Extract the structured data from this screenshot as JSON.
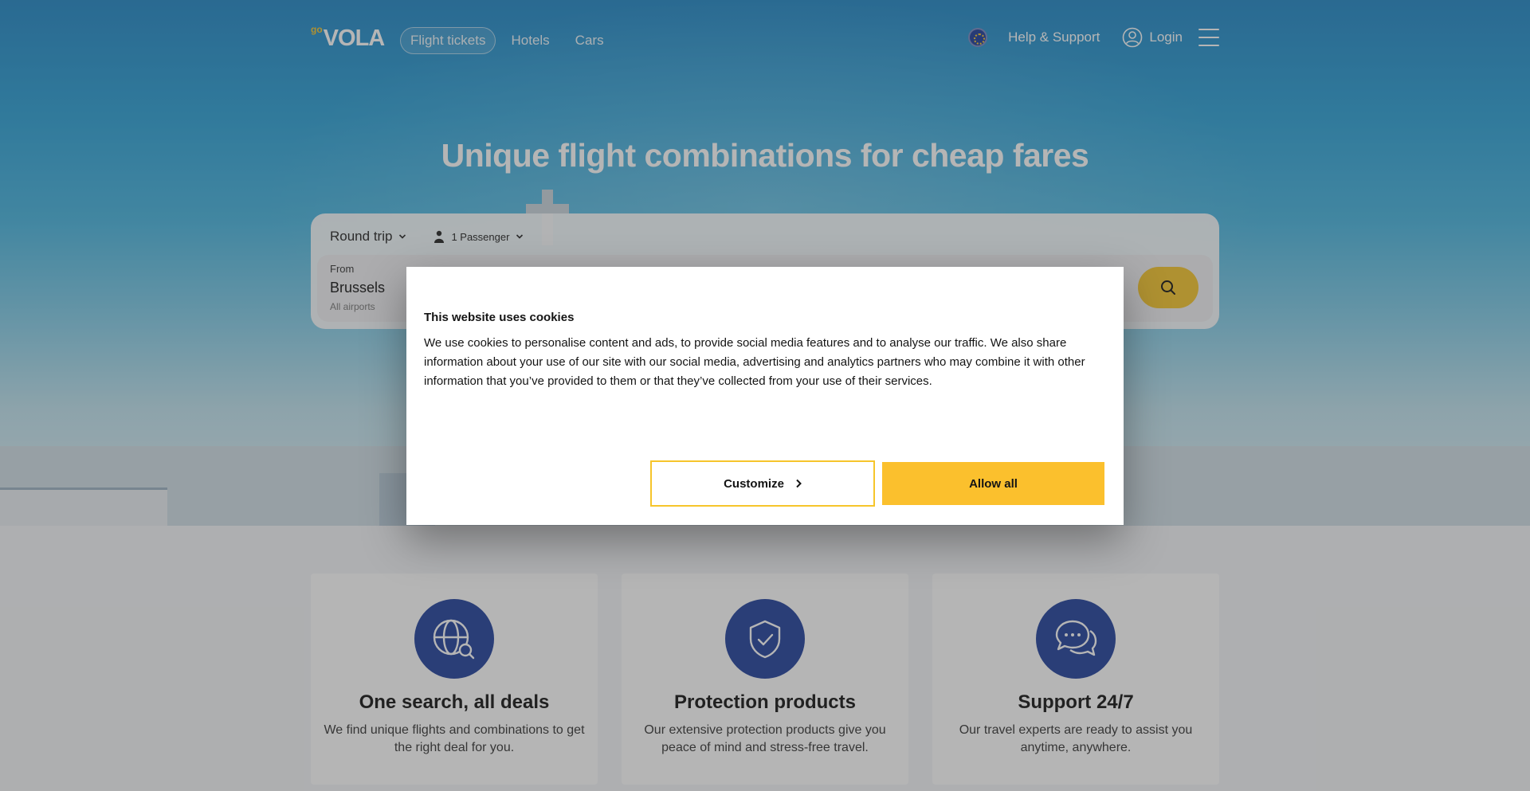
{
  "header": {
    "logo_go": "go",
    "logo_vola": "VOLA",
    "nav": [
      "Flight tickets",
      "Hotels",
      "Cars"
    ],
    "help": "Help & Support",
    "login": "Login"
  },
  "hero": {
    "title": "Unique flight combinations for cheap fares"
  },
  "search": {
    "trip_type": "Round trip",
    "passengers": "1 Passenger",
    "from_label": "From",
    "from_value": "Brussels",
    "from_sub": "All airports"
  },
  "features": [
    {
      "title": "One search, all deals",
      "text": "We find unique flights and combinations to get the right deal for you.",
      "icon": "globe-search-icon"
    },
    {
      "title": "Protection products",
      "text": "Our extensive protection products give you peace of mind and stress-free travel.",
      "icon": "shield-check-icon"
    },
    {
      "title": "Support 24/7",
      "text": "Our travel experts are ready to assist you anytime, anywhere.",
      "icon": "chat-bubbles-icon"
    }
  ],
  "cookie": {
    "title": "This website uses cookies",
    "body": "We use cookies to personalise content and ads, to provide social media features and to analyse our traffic. We also share information about your use of our site with our social media, advertising and analytics partners who may combine it with other information that you’ve provided to them or that they’ve collected from your use of their services.",
    "customize": "Customize",
    "allow_all": "Allow all"
  },
  "colors": {
    "accent_yellow": "#f6c52b",
    "brand_blue": "#1f3f9c"
  }
}
